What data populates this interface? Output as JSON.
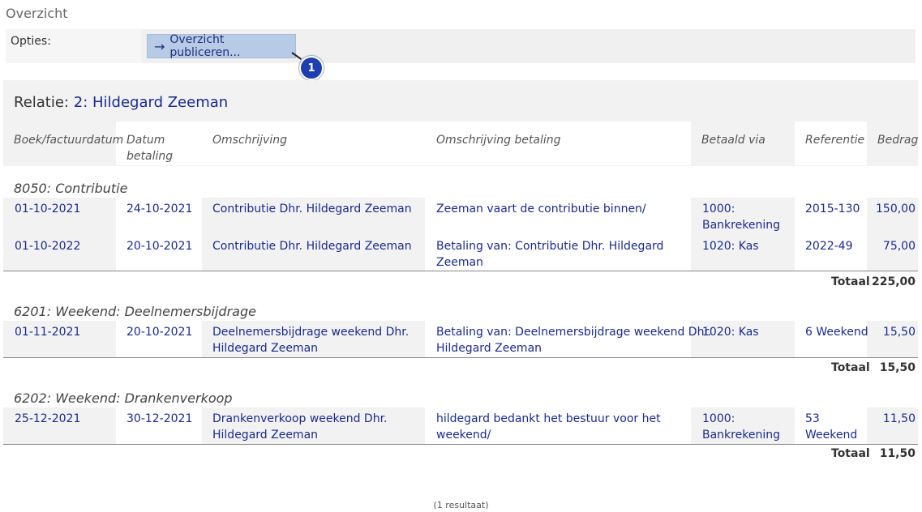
{
  "page": {
    "title": "Overzicht"
  },
  "options": {
    "label": "Opties:",
    "publish_button": "Overzicht publiceren...",
    "badge": "1"
  },
  "relation": {
    "prefix": "Relatie:",
    "name": "2: Hildegard Zeeman"
  },
  "columns": {
    "c1": "Boek/factuurdatum",
    "c2a": "Datum",
    "c2b": "betaling",
    "c3": "Omschrijving",
    "c4": "Omschrijving betaling",
    "c5": "Betaald via",
    "c6": "Referentie",
    "c7": "Bedrag"
  },
  "groups": [
    {
      "title": "8050: Contributie",
      "rows": [
        {
          "date": "01-10-2021",
          "paydate": "24-10-2021",
          "desc1": "Contributie Dhr. Hildegard Zeeman",
          "desc2": "",
          "paydesc1": "Zeeman vaart de contributie binnen/",
          "paydesc2": "",
          "via1": "1000:",
          "via2": "Bankrekening",
          "ref1": "2015-130",
          "ref2": "",
          "amount": "150,00"
        },
        {
          "date": "01-10-2022",
          "paydate": "20-10-2021",
          "desc1": "Contributie Dhr. Hildegard Zeeman",
          "desc2": "",
          "paydesc1": "Betaling van: Contributie Dhr. Hildegard",
          "paydesc2": "Zeeman",
          "via1": "1020: Kas",
          "via2": "",
          "ref1": "2022-49",
          "ref2": "",
          "amount": "75,00"
        }
      ],
      "total_label": "Totaal",
      "total": "225,00"
    },
    {
      "title": "6201: Weekend: Deelnemersbijdrage",
      "rows": [
        {
          "date": "01-11-2021",
          "paydate": "20-10-2021",
          "desc1": "Deelnemersbijdrage weekend Dhr.",
          "desc2": "Hildegard Zeeman",
          "paydesc1": "Betaling van: Deelnemersbijdrage weekend Dhr.",
          "paydesc2": "Hildegard Zeeman",
          "via1": "1020: Kas",
          "via2": "",
          "ref1": "6 Weekend",
          "ref2": "",
          "amount": "15,50"
        }
      ],
      "total_label": "Totaal",
      "total": "15,50"
    },
    {
      "title": "6202: Weekend: Drankenverkoop",
      "rows": [
        {
          "date": "25-12-2021",
          "paydate": "30-12-2021",
          "desc1": "Drankenverkoop weekend Dhr.",
          "desc2": "Hildegard Zeeman",
          "paydesc1": "hildegard bedankt het bestuur voor het",
          "paydesc2": "weekend/",
          "via1": "1000:",
          "via2": "Bankrekening",
          "ref1": "53",
          "ref2": "Weekend",
          "amount": "11,50"
        }
      ],
      "total_label": "Totaal",
      "total": "11,50"
    }
  ],
  "footer": "(1 resultaat)"
}
